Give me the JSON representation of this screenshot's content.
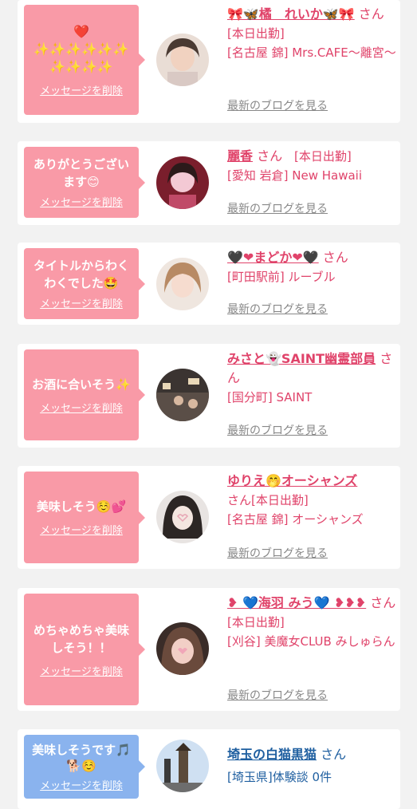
{
  "delete_label": "メッセージを削除",
  "blog_label": "最新のブログを見る",
  "cards": [
    {
      "message": "❤️\n✨✨✨✨✨✨\n✨✨✨✨",
      "name": "🎀🦋橘　れいか🦋🎀",
      "san": "さん",
      "detail": "[本日出勤]\n[名古屋 錦] Mrs.CAFE〜離宮〜"
    },
    {
      "message": "ありがとうございます😊",
      "name": "麗香",
      "san": "さん",
      "detail": "[本日出勤]\n[愛知 岩倉] New Hawaii"
    },
    {
      "message": "タイトルからわくわくでした🤩",
      "name": "🖤❤まどか❤🖤",
      "san": "さん",
      "detail": "[町田駅前] ルーブル"
    },
    {
      "message": "お酒に合いそう✨",
      "name": "みさと👻SAINT幽霊部員",
      "san": "さん",
      "detail": "[国分町] SAINT"
    },
    {
      "message": "美味しそう☺️💕",
      "name": "ゆりえ🤭オーシャンズ",
      "san": "さん",
      "detail": "[本日出勤]\n[名古屋 錦] オーシャンズ"
    },
    {
      "message": "めちゃめちゃ美味しそう！！",
      "name": "❥ 💙海羽 みう💙 ❥❥❥",
      "san": "さん",
      "detail": "[本日出勤]\n[刈谷] 美魔女CLUB みしゅらん"
    },
    {
      "message": "美味しそうです🎵\n🐕☺️",
      "name": "埼玉の白猫黒猫",
      "san": "さん",
      "detail": "[埼玉県]体験談 0件"
    }
  ]
}
